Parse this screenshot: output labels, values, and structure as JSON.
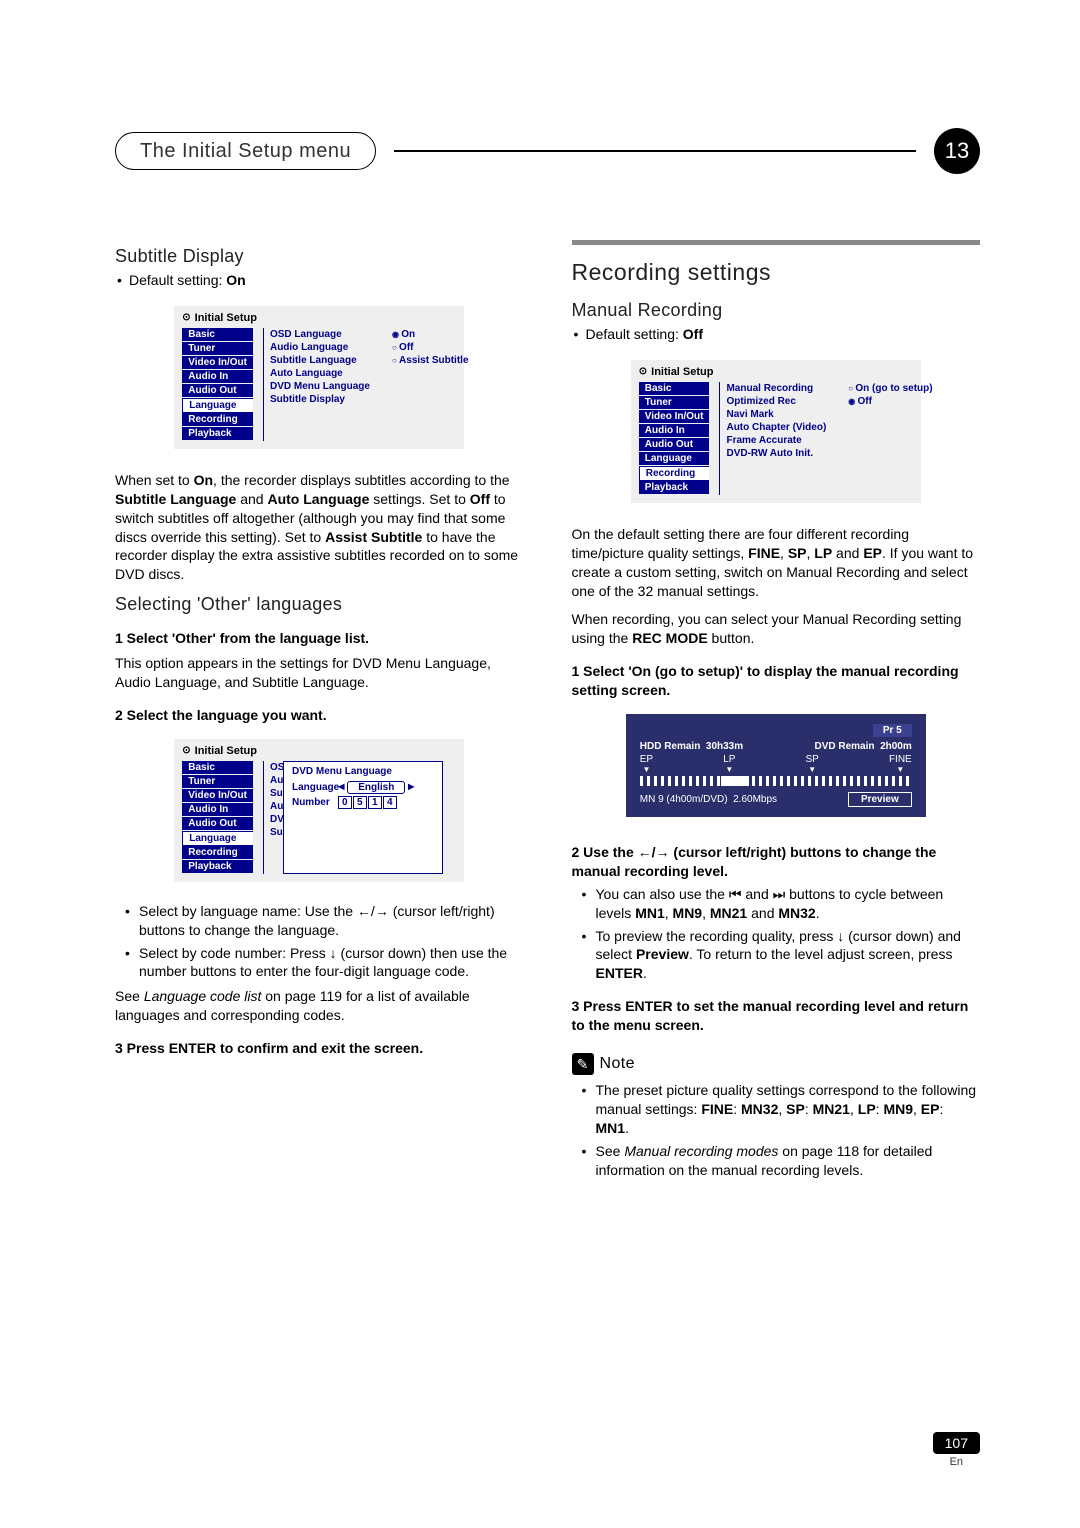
{
  "header": {
    "chapter_title": "The Initial Setup menu",
    "chapter_number": "13"
  },
  "left": {
    "h1": "Subtitle Display",
    "default_line": "Default setting: ",
    "default_value": "On",
    "osd1": {
      "title": "Initial Setup",
      "nav": [
        "Basic",
        "Tuner",
        "Video In/Out",
        "Audio In",
        "Audio Out",
        "Language",
        "Recording",
        "Playback"
      ],
      "nav_selected": "Language",
      "mid": [
        "OSD Language",
        "Audio Language",
        "Subtitle Language",
        "Auto Language",
        "DVD Menu Language",
        "Subtitle Display"
      ],
      "opts": [
        "On",
        "Off",
        "Assist Subtitle"
      ],
      "opts_selected": "On"
    },
    "p1a": "When set to ",
    "p1b": ", the recorder displays subtitles according to the ",
    "p1c": " and ",
    "p1d": " settings. Set to ",
    "p1e": " to switch subtitles off altogether (although you may find that some discs override this setting). Set to ",
    "p1f": " to have the recorder display the extra assistive subtitles recorded on to some DVD discs.",
    "b_on": "On",
    "b_sublang": "Subtitle Language",
    "b_autolang": "Auto Language",
    "b_off": "Off",
    "b_assist": "Assist Subtitle",
    "h2": "Selecting 'Other' languages",
    "step1": "1    Select 'Other' from the language list.",
    "p2": "This option appears in the settings for DVD Menu Language, Audio Language, and Subtitle Language.",
    "step2": "2    Select the language you want.",
    "osd2": {
      "title": "Initial Setup",
      "nav": [
        "Basic",
        "Tuner",
        "Video In/Out",
        "Audio In",
        "Audio Out",
        "Language",
        "Recording",
        "Playback"
      ],
      "nav_selected": "Language",
      "mid_trunc": [
        "OSD L",
        "Audio",
        "Subtit",
        "Auto L",
        "DVD M",
        "Subtit"
      ],
      "popup_title": "DVD Menu Language",
      "lang_label": "Language",
      "lang_value": "English",
      "num_label": "Number",
      "digits": [
        "0",
        "5",
        "1",
        "4"
      ]
    },
    "li1a": "Select by language name: Use the ",
    "li1b": " (cursor left/right) buttons to change the language.",
    "li2a": "Select by code number: Press ",
    "li2b": " (cursor down) then use the number buttons to enter the four-digit language code.",
    "p3a": "See ",
    "p3b": " on page 119 for a list of available languages and corresponding codes.",
    "i_langlist": "Language code list",
    "step3": "3    Press ENTER to confirm and exit the screen."
  },
  "right": {
    "section": "Recording settings",
    "h1": "Manual Recording",
    "default_line": "Default setting: ",
    "default_value": "Off",
    "osd": {
      "title": "Initial Setup",
      "nav": [
        "Basic",
        "Tuner",
        "Video In/Out",
        "Audio In",
        "Audio Out",
        "Language",
        "Recording",
        "Playback"
      ],
      "nav_selected": "Recording",
      "mid": [
        "Manual Recording",
        "Optimized Rec",
        "Navi Mark",
        "Auto Chapter (Video)",
        "Frame Accurate",
        "DVD-RW Auto Init."
      ],
      "opts": [
        "On (go to setup)",
        "Off"
      ],
      "opts_selected": "Off"
    },
    "p1a": "On the default setting there are four different recording time/picture quality settings, ",
    "p1_fine": "FINE",
    "p1_sp": "SP",
    "p1_lp": "LP",
    "p1_ep": "EP",
    "p1b": ". If you want to create a custom setting, switch on Manual Recording and select one of the 32 manual settings.",
    "p2a": "When recording, you can select your Manual Recording setting using the ",
    "p2_rec": "REC MODE",
    "p2b": " button.",
    "step1": "1    Select 'On (go to setup)' to display the manual recording setting screen.",
    "mr": {
      "pr": "Pr 5",
      "hdd_label": "HDD Remain",
      "hdd_val": "30h33m",
      "dvd_label": "DVD Remain",
      "dvd_val": "2h00m",
      "marks": [
        "EP",
        "LP",
        "SP",
        "FINE"
      ],
      "mn_label": "MN 9 (4h00m/DVD)",
      "bitrate": "2.60Mbps",
      "preview": "Preview"
    },
    "step2a": "2    Use the ",
    "step2b": " (cursor left/right) buttons to change the manual recording level.",
    "li1a": "You can also use the ",
    "li1b": " and ",
    "li1c": " buttons to cycle between levels ",
    "mn1": "MN1",
    "mn9": "MN9",
    "mn21": "MN21",
    "mn32": "MN32",
    "li1d": " and ",
    "li2a": "To preview the recording quality, press ",
    "li2b": " (cursor down) and select ",
    "b_preview": "Preview",
    "li2c": ". To return to the level adjust screen, press ",
    "b_enter": "ENTER",
    "step3": "3    Press ENTER to set the manual recording level and return to the menu screen.",
    "note_label": "Note",
    "note1a": "The preset picture quality settings correspond to the following manual settings: ",
    "n_fine": "FINE",
    "n_mn32": "MN32",
    "n_sp": "SP",
    "n_mn21": "MN21",
    "n_lp": "LP",
    "n_mn9": "MN9",
    "n_ep": "EP",
    "n_mn1": "MN1",
    "note2a": "See ",
    "note2i": "Manual recording modes",
    "note2b": " on page 118 for detailed information on the manual recording levels."
  },
  "footer": {
    "page": "107",
    "lang": "En"
  },
  "glyph": {
    "left": "←",
    "right": "→",
    "down": "↓",
    "prev": "⏮",
    "next": "⏭",
    "sep": "/"
  }
}
